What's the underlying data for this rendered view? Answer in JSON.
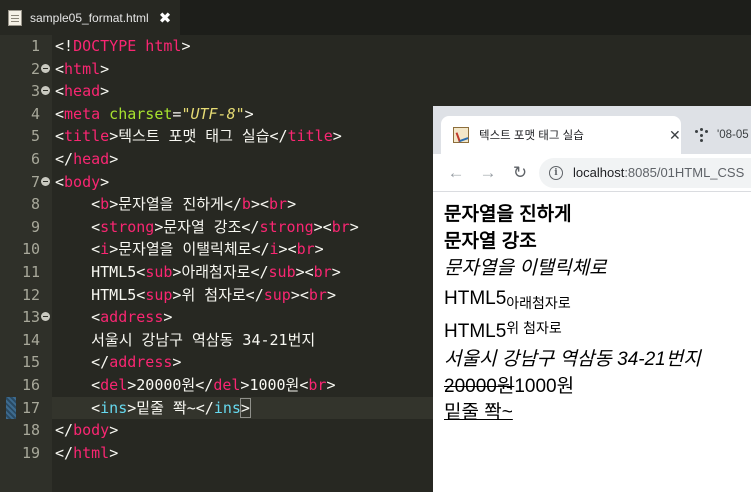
{
  "editor": {
    "tab_title": "sample05_format.html",
    "tab_close": "✖",
    "line_numbers": [
      "1",
      "2",
      "3",
      "4",
      "5",
      "6",
      "7",
      "8",
      "9",
      "10",
      "11",
      "12",
      "13",
      "14",
      "15",
      "16",
      "17",
      "18",
      "19"
    ],
    "lines": {
      "l1": {
        "a": "<!",
        "b": "DOCTYPE",
        "c": " html",
        "d": ">"
      },
      "l2": {
        "a": "<",
        "b": "html",
        "c": ">"
      },
      "l3": {
        "a": "<",
        "b": "head",
        "c": ">"
      },
      "l4": {
        "a": "<",
        "b": "meta",
        "c": " charset",
        "d": "=",
        "e": "\"UTF-8\"",
        "f": ">"
      },
      "l5": {
        "a": "<",
        "b": "title",
        "c": ">",
        "d": "텍스트 포맷 태그 실습",
        "e": "</",
        "f": "title",
        "g": ">"
      },
      "l6": {
        "a": "</",
        "b": "head",
        "c": ">"
      },
      "l7": {
        "a": "<",
        "b": "body",
        "c": ">"
      },
      "l8": {
        "indent": "    ",
        "a": "<",
        "b": "b",
        "c": ">",
        "d": "문자열을 진하게",
        "e": "</",
        "f": "b",
        "g": "><",
        "h": "br",
        "i": ">"
      },
      "l9": {
        "indent": "    ",
        "a": "<",
        "b": "strong",
        "c": ">",
        "d": "문자열 강조",
        "e": "</",
        "f": "strong",
        "g": "><",
        "h": "br",
        "i": ">"
      },
      "l10": {
        "indent": "    ",
        "a": "<",
        "b": "i",
        "c": ">",
        "d": "문자열을 이탤릭체로",
        "e": "</",
        "f": "i",
        "g": "><",
        "h": "br",
        "i": ">"
      },
      "l11": {
        "indent": "    ",
        "pre": "HTML5",
        "a": "<",
        "b": "sub",
        "c": ">",
        "d": "아래첨자로",
        "e": "</",
        "f": "sub",
        "g": "><",
        "h": "br",
        "i": ">"
      },
      "l12": {
        "indent": "    ",
        "pre": "HTML5",
        "a": "<",
        "b": "sup",
        "c": ">",
        "d": "위 첨자로",
        "e": "</",
        "f": "sup",
        "g": "><",
        "h": "br",
        "i": ">"
      },
      "l13": {
        "indent": "    ",
        "a": "<",
        "b": "address",
        "c": ">"
      },
      "l14": {
        "indent": "    ",
        "d": "서울시 강남구 역삼동 34-21번지"
      },
      "l15": {
        "indent": "    ",
        "a": "</",
        "b": "address",
        "c": ">"
      },
      "l16": {
        "indent": "    ",
        "a": "<",
        "b": "del",
        "c": ">",
        "d": "20000원",
        "e": "</",
        "f": "del",
        "g": ">",
        "h": "1000원",
        "i": "<",
        "j": "br",
        "k": ">"
      },
      "l17": {
        "indent": "    ",
        "a": "<",
        "b": "ins",
        "c": ">",
        "d": "밑줄 쫙~",
        "e": "</",
        "f": "ins",
        "g": ">"
      },
      "l18": {
        "a": "</",
        "b": "body",
        "c": ">"
      },
      "l19": {
        "a": "</",
        "b": "html",
        "c": ">"
      }
    }
  },
  "browser": {
    "tab_title": "텍스트 포맷 태그 실습",
    "tab_close": "✕",
    "inactive_tab_title": "'08-05",
    "url_host": "localhost",
    "url_rest": ":8085/01HTML_CSS",
    "content": {
      "bold": "문자열을 진하게",
      "strong": "문자열 강조",
      "italic": "문자열을 이탤릭체로",
      "sub_base": "HTML5",
      "sub_text": "아래첨자로",
      "sup_base": "HTML5",
      "sup_text": "위 첨자로",
      "address": "서울시 강남구 역삼동 34-21번지",
      "del_text": "20000원",
      "after_del": "1000원",
      "ins_text": "밑줄 쫙~"
    }
  },
  "icons": {
    "back": "←",
    "forward": "→",
    "reload": "↻",
    "info": "i"
  }
}
